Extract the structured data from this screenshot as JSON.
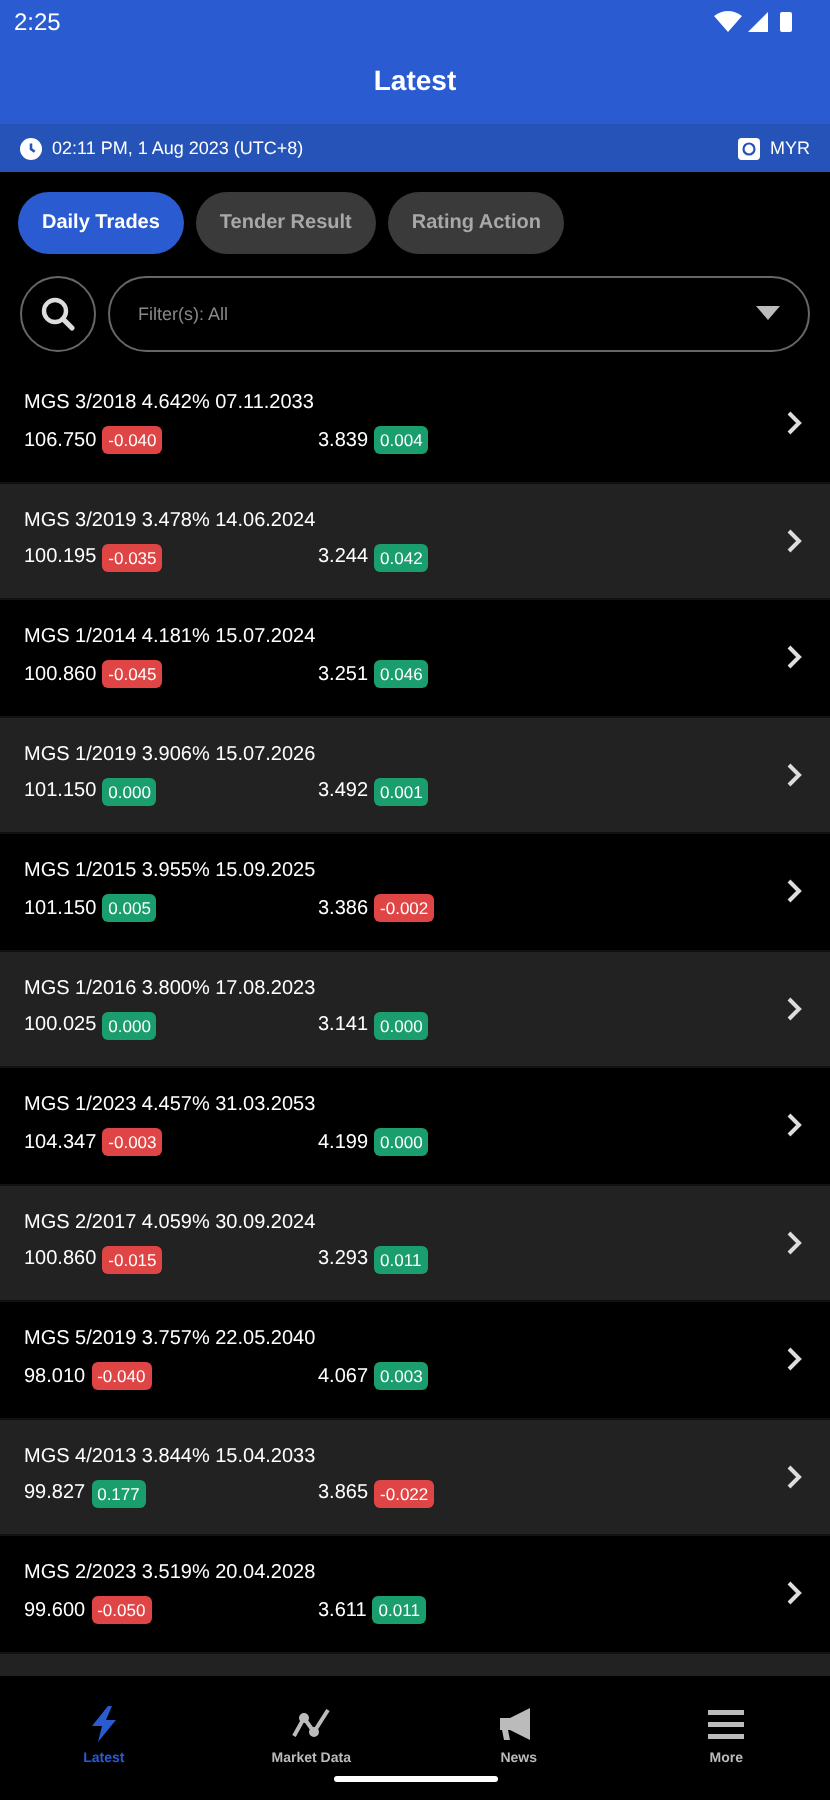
{
  "status_bar": {
    "time": "2:25"
  },
  "header": {
    "title": "Latest"
  },
  "info_bar": {
    "timestamp": "02:11 PM, 1 Aug 2023 (UTC+8)",
    "currency": "MYR"
  },
  "tabs": [
    {
      "label": "Daily Trades",
      "selected": true
    },
    {
      "label": "Tender Result",
      "selected": false
    },
    {
      "label": "Rating Action",
      "selected": false
    }
  ],
  "filter": {
    "value": "Filter(s): All"
  },
  "trades": [
    {
      "name": "MGS 3/2018 4.642% 07.11.2033",
      "price": "106.750",
      "price_change": "-0.040",
      "price_up": false,
      "yield": "3.839",
      "yield_change": "0.004",
      "yield_up": true
    },
    {
      "name": "MGS 3/2019 3.478% 14.06.2024",
      "price": "100.195",
      "price_change": "-0.035",
      "price_up": false,
      "yield": "3.244",
      "yield_change": "0.042",
      "yield_up": true
    },
    {
      "name": "MGS 1/2014 4.181% 15.07.2024",
      "price": "100.860",
      "price_change": "-0.045",
      "price_up": false,
      "yield": "3.251",
      "yield_change": "0.046",
      "yield_up": true
    },
    {
      "name": "MGS 1/2019 3.906% 15.07.2026",
      "price": "101.150",
      "price_change": "0.000",
      "price_up": true,
      "yield": "3.492",
      "yield_change": "0.001",
      "yield_up": true
    },
    {
      "name": "MGS 1/2015 3.955% 15.09.2025",
      "price": "101.150",
      "price_change": "0.005",
      "price_up": true,
      "yield": "3.386",
      "yield_change": "-0.002",
      "yield_up": false
    },
    {
      "name": "MGS 1/2016 3.800% 17.08.2023",
      "price": "100.025",
      "price_change": "0.000",
      "price_up": true,
      "yield": "3.141",
      "yield_change": "0.000",
      "yield_up": true
    },
    {
      "name": "MGS 1/2023 4.457% 31.03.2053",
      "price": "104.347",
      "price_change": "-0.003",
      "price_up": false,
      "yield": "4.199",
      "yield_change": "0.000",
      "yield_up": true
    },
    {
      "name": "MGS 2/2017 4.059% 30.09.2024",
      "price": "100.860",
      "price_change": "-0.015",
      "price_up": false,
      "yield": "3.293",
      "yield_change": "0.011",
      "yield_up": true
    },
    {
      "name": "MGS 5/2019 3.757% 22.05.2040",
      "price": "98.010",
      "price_change": "-0.040",
      "price_up": false,
      "yield": "4.067",
      "yield_change": "0.003",
      "yield_up": true
    },
    {
      "name": "MGS 4/2013 3.844% 15.04.2033",
      "price": "99.827",
      "price_change": "0.177",
      "price_up": true,
      "yield": "3.865",
      "yield_change": "-0.022",
      "yield_up": false
    },
    {
      "name": "MGS 2/2023 3.519% 20.04.2028",
      "price": "99.600",
      "price_change": "-0.050",
      "price_up": false,
      "yield": "3.611",
      "yield_change": "0.011",
      "yield_up": true
    }
  ],
  "nav": [
    {
      "kind": "bolt",
      "label": "Latest",
      "selected": true
    },
    {
      "kind": "chart",
      "label": "Market Data",
      "selected": false
    },
    {
      "kind": "megaphone",
      "label": "News",
      "selected": false
    },
    {
      "kind": "menu",
      "label": "More",
      "selected": false
    }
  ]
}
